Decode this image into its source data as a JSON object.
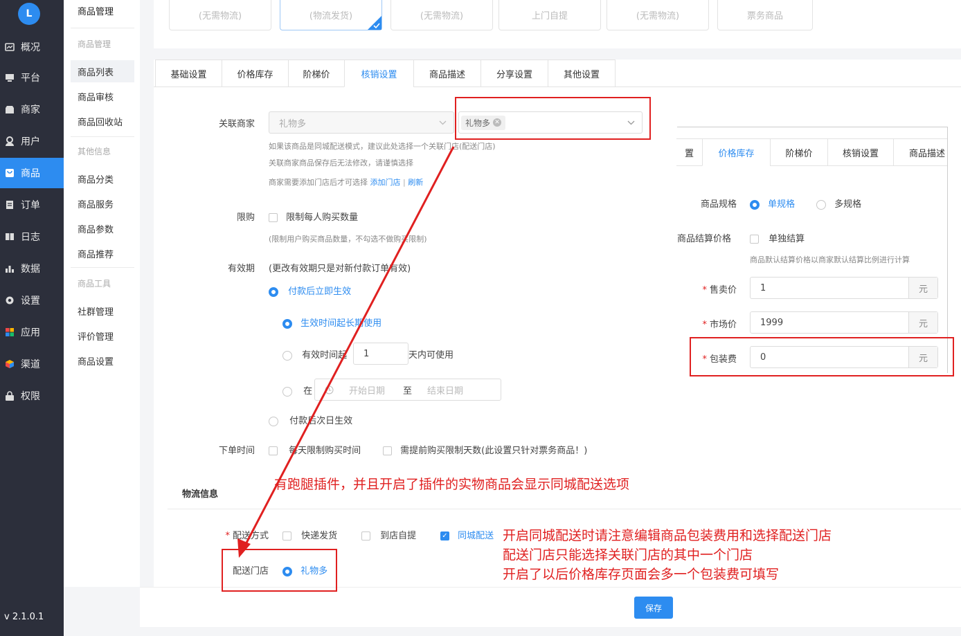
{
  "sidebar": {
    "logo": "L",
    "items": [
      {
        "label": "概况",
        "icon": "dashboard-icon"
      },
      {
        "label": "平台",
        "icon": "monitor-icon"
      },
      {
        "label": "商家",
        "icon": "store-icon"
      },
      {
        "label": "用户",
        "icon": "user-icon"
      },
      {
        "label": "商品",
        "icon": "goods-icon"
      },
      {
        "label": "订单",
        "icon": "order-icon"
      },
      {
        "label": "日志",
        "icon": "log-icon"
      },
      {
        "label": "数据",
        "icon": "chart-icon"
      },
      {
        "label": "设置",
        "icon": "gear-icon"
      },
      {
        "label": "应用",
        "icon": "apps-icon"
      },
      {
        "label": "渠道",
        "icon": "cube-icon"
      },
      {
        "label": "权限",
        "icon": "lock-icon"
      }
    ],
    "active_index": 4,
    "version": "v 2.1.0.1"
  },
  "submenu": {
    "title": "商品管理",
    "groups": [
      {
        "label": "商品管理",
        "items": [
          "商品列表",
          "商品审核",
          "商品回收站"
        ]
      },
      {
        "label": "其他信息",
        "items": [
          "商品分类",
          "商品服务",
          "商品参数",
          "商品推荐"
        ]
      },
      {
        "label": "商品工具",
        "items": [
          "社群管理",
          "评价管理",
          "商品设置"
        ]
      }
    ],
    "active_item": "商品列表"
  },
  "shipping_types": [
    "(无需物流)",
    "(物流发货)",
    "(无需物流)",
    "上门自提",
    "(无需物流)",
    "票务商品"
  ],
  "tabs": [
    "基础设置",
    "价格库存",
    "阶梯价",
    "核销设置",
    "商品描述",
    "分享设置",
    "其他设置"
  ],
  "active_tab": "核销设置",
  "form": {
    "merchant": {
      "label": "关联商家",
      "select_value": "礼物多",
      "tag_value": "礼物多",
      "tips": [
        "如果该商品是同城配送模式，建议此处选择一个关联门店(配送门店)",
        "关联商家商品保存后无法修改，请谨慎选择",
        "商家需要添加门店后才可选择"
      ],
      "add_store_link": "添加门店",
      "refresh_link": "刷新"
    },
    "limit": {
      "label": "限购",
      "checkbox_label": "限制每人购买数量",
      "tip": "(限制用户购买商品数量，不勾选不做购买限制)"
    },
    "validity": {
      "label": "有效期",
      "note": "(更改有效期只是对新付款订单有效)",
      "option_immediate": "付款后立即生效",
      "sub_long_term": "生效时间起长期使用",
      "sub_days_prefix": "有效时间起",
      "sub_days_value": "1",
      "sub_days_suffix": "天内可使用",
      "sub_range_prefix": "在",
      "start_placeholder": "开始日期",
      "range_sep": "至",
      "end_placeholder": "结束日期",
      "option_next_day": "付款后次日生效"
    },
    "order_time": {
      "label": "下单时间",
      "daily_limit": "每天限制购买时间",
      "advance_days": "需提前购买限制天数(此设置只针对票务商品！)"
    },
    "logistics": {
      "section_title": "物流信息",
      "delivery_label": "配送方式",
      "express": "快递发货",
      "pickup": "到店自提",
      "local": "同城配送",
      "store_label": "配送门店",
      "store_value": "礼物多"
    }
  },
  "inset": {
    "tabs": [
      "置",
      "价格库存",
      "阶梯价",
      "核销设置",
      "商品描述"
    ],
    "active_tab": "价格库存",
    "spec_label": "商品规格",
    "spec_single": "单规格",
    "spec_multi": "多规格",
    "settle_label": "商品结算价格",
    "settle_checkbox": "单独结算",
    "settle_tip": "商品默认结算价格以商家默认结算比例进行计算",
    "price_label": "售卖价",
    "price_value": "1",
    "market_label": "市场价",
    "market_value": "1999",
    "package_label": "包装费",
    "package_value": "0",
    "unit": "元"
  },
  "annotations": {
    "plugin_note": "有跑腿插件，并且开启了插件的实物商品会显示同城配送选项",
    "notes": [
      "开启同城配送时请注意编辑商品包装费用和选择配送门店",
      "配送门店只能选择关联门店的其中一个门店",
      "开启了以后价格库存页面会多一个包装费可填写"
    ]
  },
  "save_button": "保存",
  "colors": {
    "accent": "#2d8cf0",
    "sidebar": "#2c2f3b",
    "annotation": "#e02020"
  }
}
